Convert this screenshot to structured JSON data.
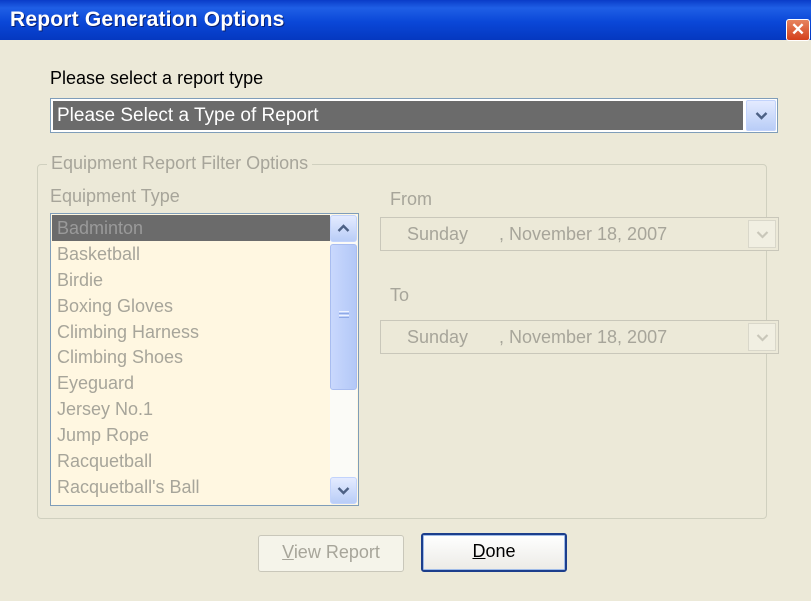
{
  "window": {
    "title": "Report Generation Options",
    "close_glyph": "✕"
  },
  "report_type": {
    "label": "Please select a report type",
    "selected": "Please Select a Type of Report",
    "icon": "chevron-down-icon"
  },
  "filter_group": {
    "title": "Equipment Report Filter Options",
    "equipment_type_label": "Equipment Type",
    "equipment_items": [
      "Badminton",
      "Basketball",
      "Birdie",
      "Boxing Gloves",
      "Climbing Harness",
      "Climbing Shoes",
      "Eyeguard",
      "Jersey No.1",
      "Jump Rope",
      "Racquetball",
      "Racquetball's Ball"
    ],
    "selected_index": 0,
    "from": {
      "label": "From",
      "day": "Sunday",
      "date": ", November 18, 2007"
    },
    "to": {
      "label": "To",
      "day": "Sunday",
      "date": ", November 18, 2007"
    }
  },
  "buttons": {
    "view_report": {
      "accel": "V",
      "rest": "iew Report"
    },
    "done": {
      "accel": "D",
      "rest": "one"
    }
  },
  "colors": {
    "titlebar": "#0a47d8",
    "face": "#ECE9D8",
    "list_bg": "#fff7e1",
    "selection": "#6b6b6b",
    "disabled_text": "#a7a59a"
  }
}
